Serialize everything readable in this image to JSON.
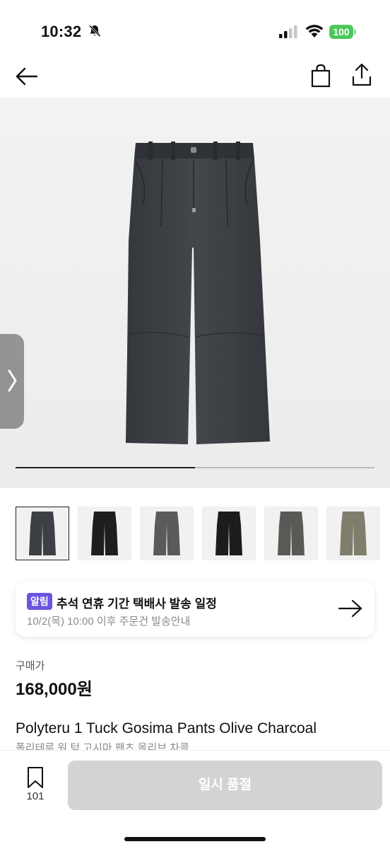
{
  "status_bar": {
    "time": "10:32",
    "battery": "100",
    "icons": [
      "bell-slash-icon",
      "signal-icon",
      "wifi-icon",
      "battery-icon"
    ]
  },
  "header": {
    "icons": [
      "back-arrow-icon",
      "shopping-bag-icon",
      "share-icon"
    ]
  },
  "gallery": {
    "progress": 0.5,
    "thumb_colors": [
      "#3c3f44",
      "#1e1e1e",
      "#585a5c",
      "#1c1c1c",
      "#5a5955",
      "#7f7e6c"
    ]
  },
  "notice": {
    "badge": "알림",
    "title": "추석 연휴 기간 택배사 발송 일정",
    "subtitle": "10/2(목) 10:00 이후 주문건 발송안내"
  },
  "price": {
    "label": "구매가",
    "value": "168,000원"
  },
  "product": {
    "name": "Polyteru 1 Tuck Gosima Pants Olive Charcoal",
    "name_kr": "폴리테루 원 턱 고시마 팬츠 올리브 차콜"
  },
  "bottom": {
    "bookmark_count": "101",
    "buy_label": "일시 품절"
  },
  "colors": {
    "accent_badge": "#6d53e0",
    "battery": "#4cc75a",
    "button_disabled": "#d3d3d3"
  }
}
